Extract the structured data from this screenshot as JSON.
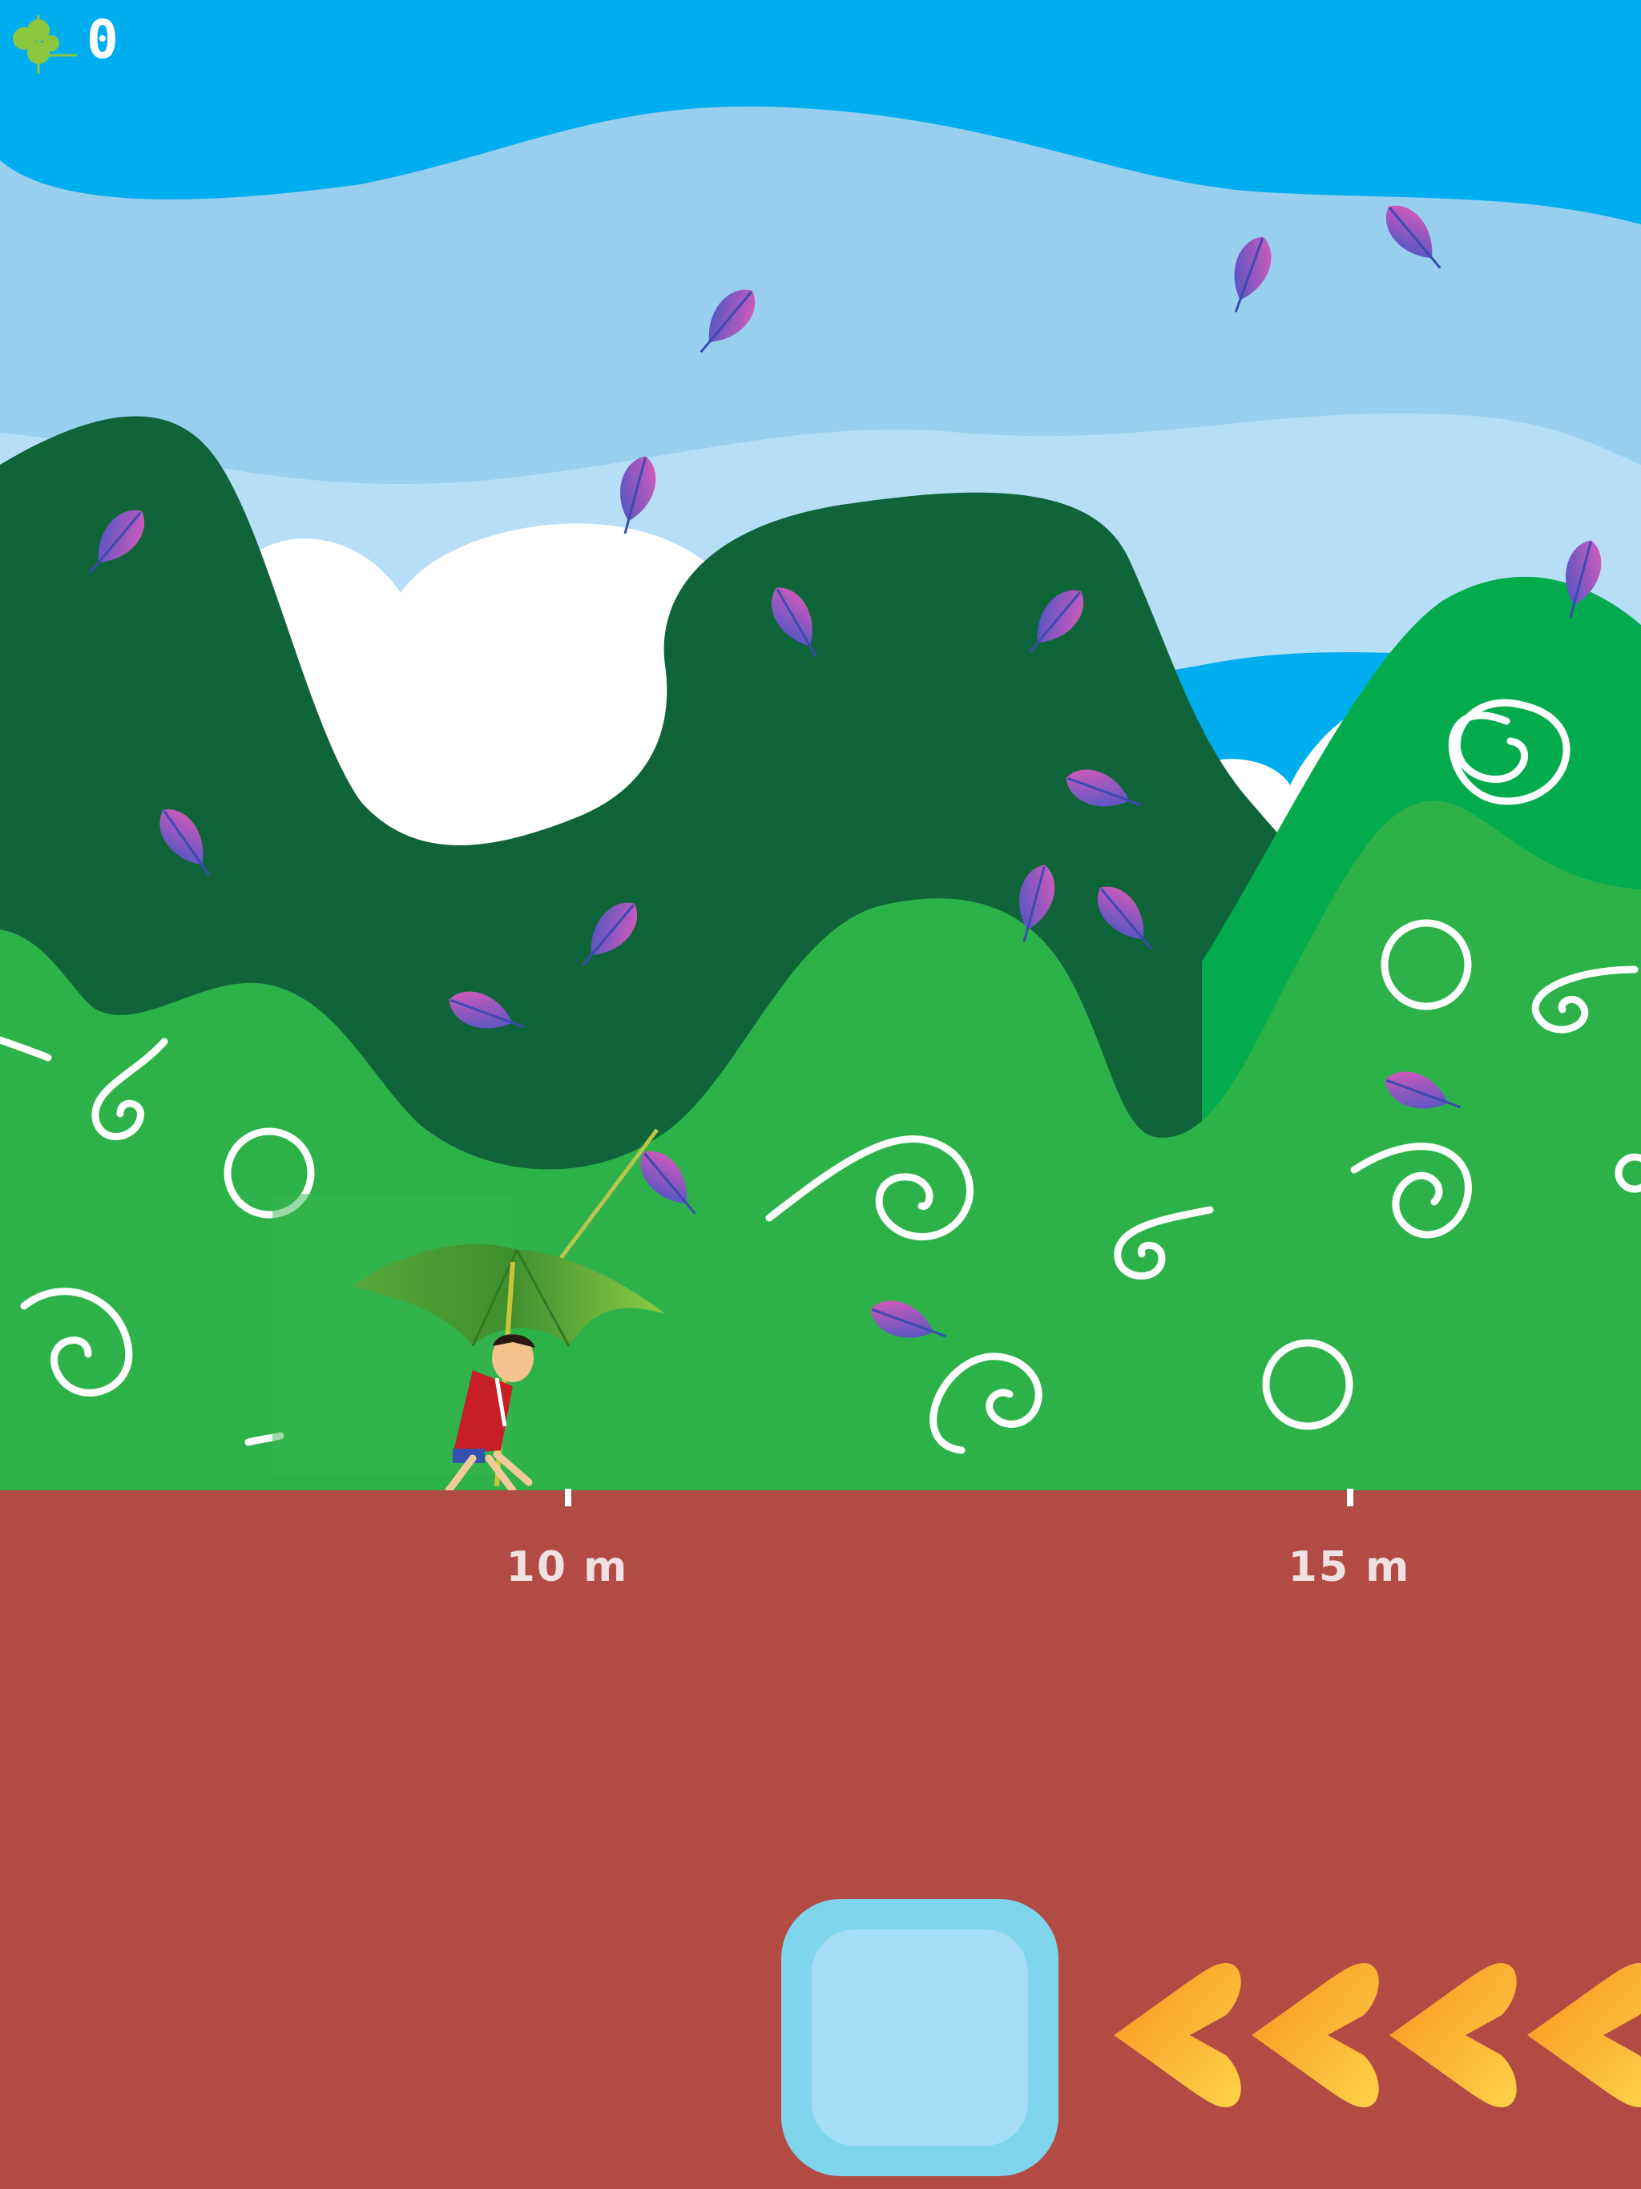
{
  "hud": {
    "score": "0",
    "score_icon": "clover-icon"
  },
  "distance_markers": [
    {
      "label": "10 m"
    },
    {
      "label": "15 m"
    }
  ],
  "controls": {
    "umbrella_button_icon": "umbrella-character-icon",
    "chevrons": [
      "chevron-left-icon",
      "chevron-left-icon",
      "chevron-left-icon",
      "chevron-left-icon"
    ]
  },
  "colors": {
    "sky": "#00aeef",
    "ground": "#b24b44",
    "hill_dark": "#0f6439",
    "hill_light": "#2db24a",
    "chevron": "#f7a41d",
    "button_outer": "#7fd5ec",
    "button_inner": "#a6ddf6"
  }
}
